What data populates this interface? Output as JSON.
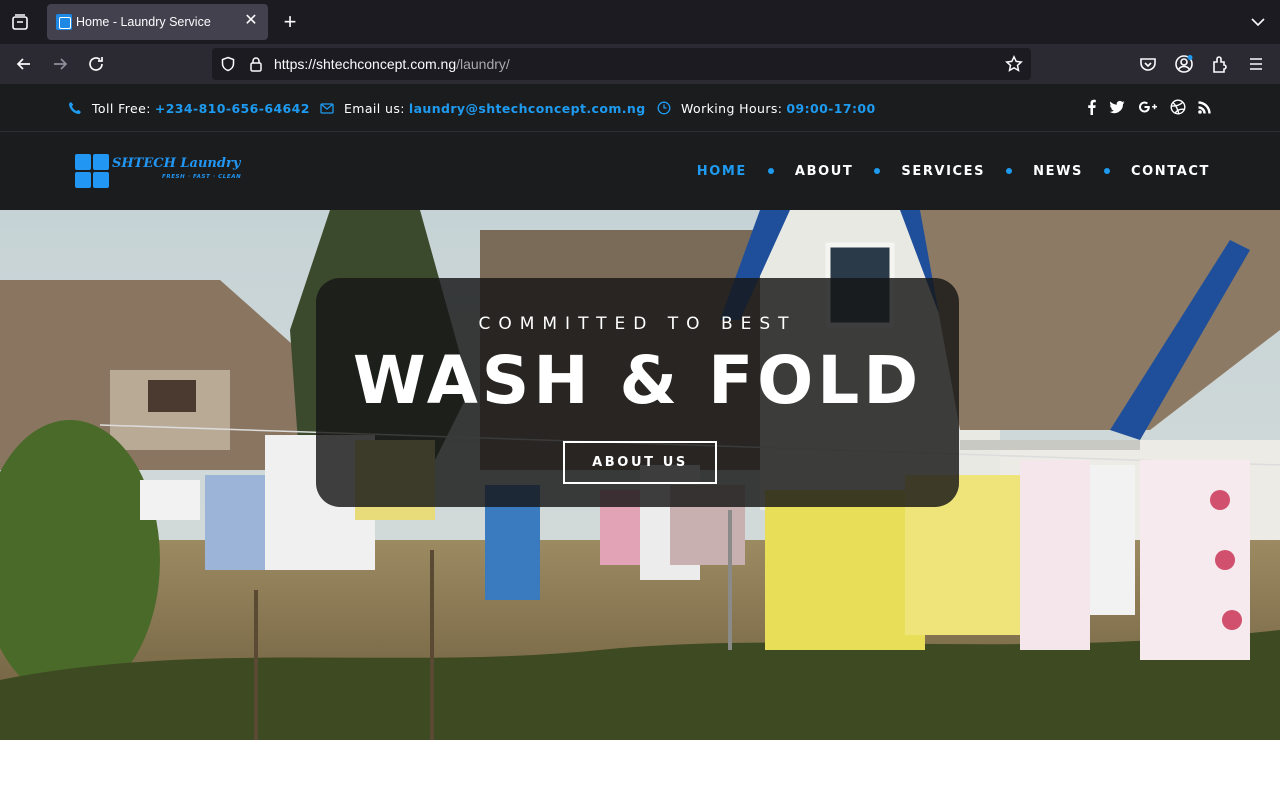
{
  "browser": {
    "tab_title": "Home - Laundry Service",
    "url_host": "https://shtechconcept.com.ng",
    "url_path": "/laundry/"
  },
  "topbar": {
    "phone": {
      "label": "Toll Free:",
      "value": "+234-810-656-64642",
      "icon": "phone-icon"
    },
    "email": {
      "label": "Email us:",
      "value": "laundry@shtechconcept.com.ng",
      "icon": "envelope-icon"
    },
    "hours": {
      "label": "Working Hours:",
      "value": "09:00-17:00",
      "icon": "clock-icon"
    },
    "social": [
      "facebook-icon",
      "twitter-icon",
      "google-plus-icon",
      "dribbble-icon",
      "rss-icon"
    ]
  },
  "logo": {
    "name": "SHTECH Laundry",
    "tagline": "FRESH · FAST · CLEAN"
  },
  "nav": {
    "items": [
      {
        "label": "HOME",
        "active": true
      },
      {
        "label": "ABOUT",
        "active": false
      },
      {
        "label": "SERVICES",
        "active": false
      },
      {
        "label": "NEWS",
        "active": false
      },
      {
        "label": "CONTACT",
        "active": false
      }
    ]
  },
  "hero": {
    "kicker": "COMMITTED TO BEST",
    "title": "WASH & FOLD",
    "button": "ABOUT US"
  },
  "colors": {
    "accent": "#1e9bf0",
    "header_bg": "#1b1c1e",
    "chrome_bg": "#1c1b22"
  }
}
